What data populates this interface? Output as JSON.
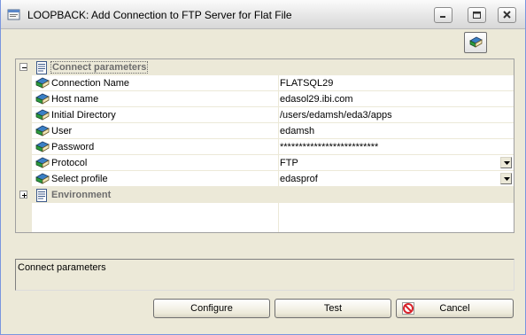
{
  "window": {
    "title": "LOOPBACK: Add Connection to FTP Server for Flat File"
  },
  "grid": {
    "categories": [
      {
        "label": "Connect parameters",
        "expanded": true,
        "properties": [
          {
            "name": "Connection Name",
            "value": "FLATSQL29"
          },
          {
            "name": "Host name",
            "value": "edasol29.ibi.com"
          },
          {
            "name": "Initial Directory",
            "value": "/users/edamsh/eda3/apps"
          },
          {
            "name": "User",
            "value": "edamsh"
          },
          {
            "name": "Password",
            "value": "**************************"
          },
          {
            "name": "Protocol",
            "value": "FTP",
            "dropdown": true
          },
          {
            "name": "Select profile",
            "value": "edasprof",
            "dropdown": true
          }
        ]
      },
      {
        "label": "Environment",
        "expanded": false
      }
    ]
  },
  "description": {
    "text": "Connect parameters"
  },
  "buttons": {
    "configure": "Configure",
    "test": "Test",
    "cancel": "Cancel"
  },
  "icons": {
    "toolbar": "book-icon",
    "category": "page-icon",
    "property": "book-icon",
    "cancel": "no-entry-icon"
  },
  "colors": {
    "window_bg": "#ece9d8",
    "grid_bg": "#ffffff",
    "category_text": "#6d6d6d",
    "cancel_icon": "#d8222a"
  }
}
